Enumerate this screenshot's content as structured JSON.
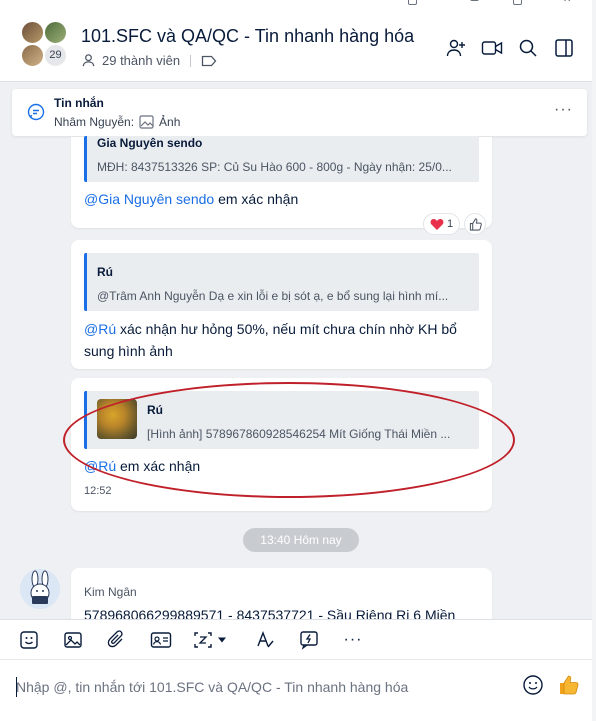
{
  "header": {
    "title": "101.SFC và QA/QC - Tin nhanh hàng hóa",
    "member_count_badge": "29",
    "members_label": "29 thành viên"
  },
  "pinned": {
    "title": "Tin nhắn",
    "sender": "Nhâm Nguyễn:",
    "content": "Ảnh"
  },
  "messages": [
    {
      "quote_name": "Gia Nguyên sendo",
      "quote_text": "MĐH: 8437513326 SP: Củ Su Hào 600 - 800g - Ngày nhận: 25/0...",
      "mention": "@Gia Nguyên sendo",
      "text": " em xác nhận",
      "reaction_count": "1"
    },
    {
      "quote_name": "Rú",
      "quote_text": "@Trâm Anh Nguyễn Dạ e xin lỗi e bị sót ạ, e bổ sung lại hình mí...",
      "mention": "@Rú",
      "text": " xác nhận hư hỏng 50%, nếu mít chưa chín nhờ KH bổ sung hình ảnh"
    },
    {
      "quote_name": "Rú",
      "quote_text": "[Hình ảnh] 578967860928546254 Mít Giống Thái Miền ...",
      "mention": "@Rú",
      "text": " em xác nhận",
      "time": "12:52"
    }
  ],
  "date_separator": "13:40 Hôm nay",
  "last_message": {
    "sender": "Kim Ngân",
    "text": "578968066299889571 - 8437537721 - Sầu Riêng Ri 6 Miền"
  },
  "composer": {
    "placeholder": "Nhập @, tin nhắn tới 101.SFC và QA/QC - Tin nhanh hàng hóa"
  },
  "colors": {
    "accent": "#1a6fe6",
    "annotation": "#c0202a",
    "heart": "#e8304a"
  }
}
